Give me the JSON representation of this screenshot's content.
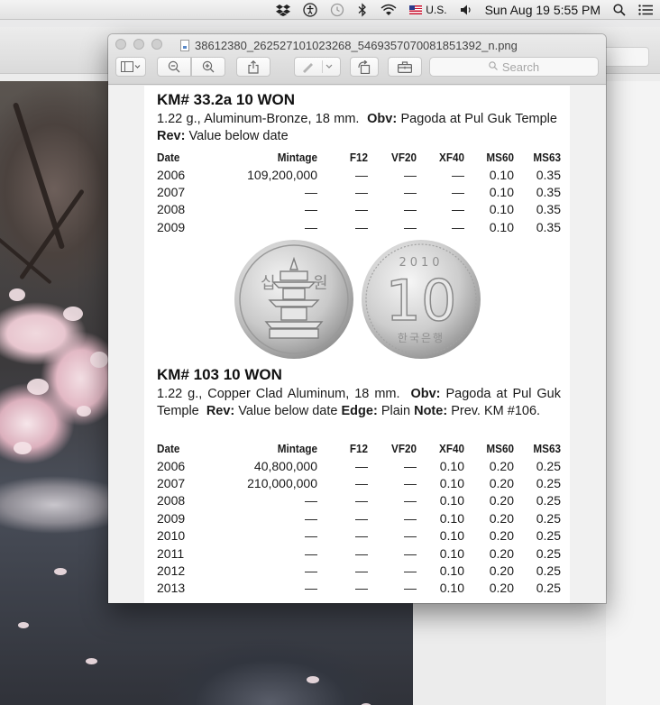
{
  "menubar": {
    "input_source": "U.S.",
    "clock": "Sun Aug 19  5:55 PM",
    "icons": [
      "dropbox-icon",
      "accessibility-icon",
      "time-machine-icon",
      "bluetooth-icon",
      "wifi-icon",
      "flag-us-icon",
      "volume-icon",
      "spotlight-icon",
      "notification-center-icon"
    ]
  },
  "window": {
    "title": "38612380_262527101023268_5469357070081851392_n.png",
    "search_placeholder": "Search",
    "toolbar_icons": [
      "sidebar-view-icon",
      "zoom-out-icon",
      "zoom-in-icon",
      "share-icon",
      "markup-pen-icon",
      "rotate-icon",
      "toolbox-icon"
    ]
  },
  "document": {
    "section1": {
      "title": "KM# 33.2a  10 WON",
      "weight_metal": "1.22 g., Aluminum-Bronze, 18 mm.",
      "obv_label": "Obv:",
      "obv_text": "Pagoda at Pul Guk Temple",
      "rev_label": "Rev:",
      "rev_text": "Value below date",
      "columns": [
        "Date",
        "Mintage",
        "F12",
        "VF20",
        "XF40",
        "MS60",
        "MS63"
      ],
      "rows": [
        [
          "2006",
          "109,200,000",
          "—",
          "—",
          "—",
          "0.10",
          "0.35"
        ],
        [
          "2007",
          "—",
          "—",
          "—",
          "—",
          "0.10",
          "0.35"
        ],
        [
          "2008",
          "—",
          "—",
          "—",
          "—",
          "0.10",
          "0.35"
        ],
        [
          "2009",
          "—",
          "—",
          "—",
          "—",
          "0.10",
          "0.35"
        ]
      ]
    },
    "coins": {
      "obverse_chars": [
        "십",
        "원"
      ],
      "reverse_year": "2010",
      "reverse_value": "10",
      "reverse_text": "한국은행"
    },
    "section2": {
      "title": "KM# 103  10 WON",
      "weight_metal": "1.22 g., Copper Clad Aluminum, 18 mm.",
      "obv_label": "Obv:",
      "obv_text": "Pagoda at Pul Guk Temple",
      "rev_label": "Rev:",
      "rev_text": "Value below date",
      "edge_label": "Edge:",
      "edge_text": "Plain",
      "note_label": "Note:",
      "note_text": "Prev. KM #106.",
      "columns": [
        "Date",
        "Mintage",
        "F12",
        "VF20",
        "XF40",
        "MS60",
        "MS63"
      ],
      "rows": [
        [
          "2006",
          "40,800,000",
          "—",
          "—",
          "0.10",
          "0.20",
          "0.25"
        ],
        [
          "2007",
          "210,000,000",
          "—",
          "—",
          "0.10",
          "0.20",
          "0.25"
        ],
        [
          "2008",
          "—",
          "—",
          "—",
          "0.10",
          "0.20",
          "0.25"
        ],
        [
          "2009",
          "—",
          "—",
          "—",
          "0.10",
          "0.20",
          "0.25"
        ],
        [
          "2010",
          "—",
          "—",
          "—",
          "0.10",
          "0.20",
          "0.25"
        ],
        [
          "2011",
          "—",
          "—",
          "—",
          "0.10",
          "0.20",
          "0.25"
        ],
        [
          "2012",
          "—",
          "—",
          "—",
          "0.10",
          "0.20",
          "0.25"
        ],
        [
          "2013",
          "—",
          "—",
          "—",
          "0.10",
          "0.20",
          "0.25"
        ]
      ]
    }
  }
}
